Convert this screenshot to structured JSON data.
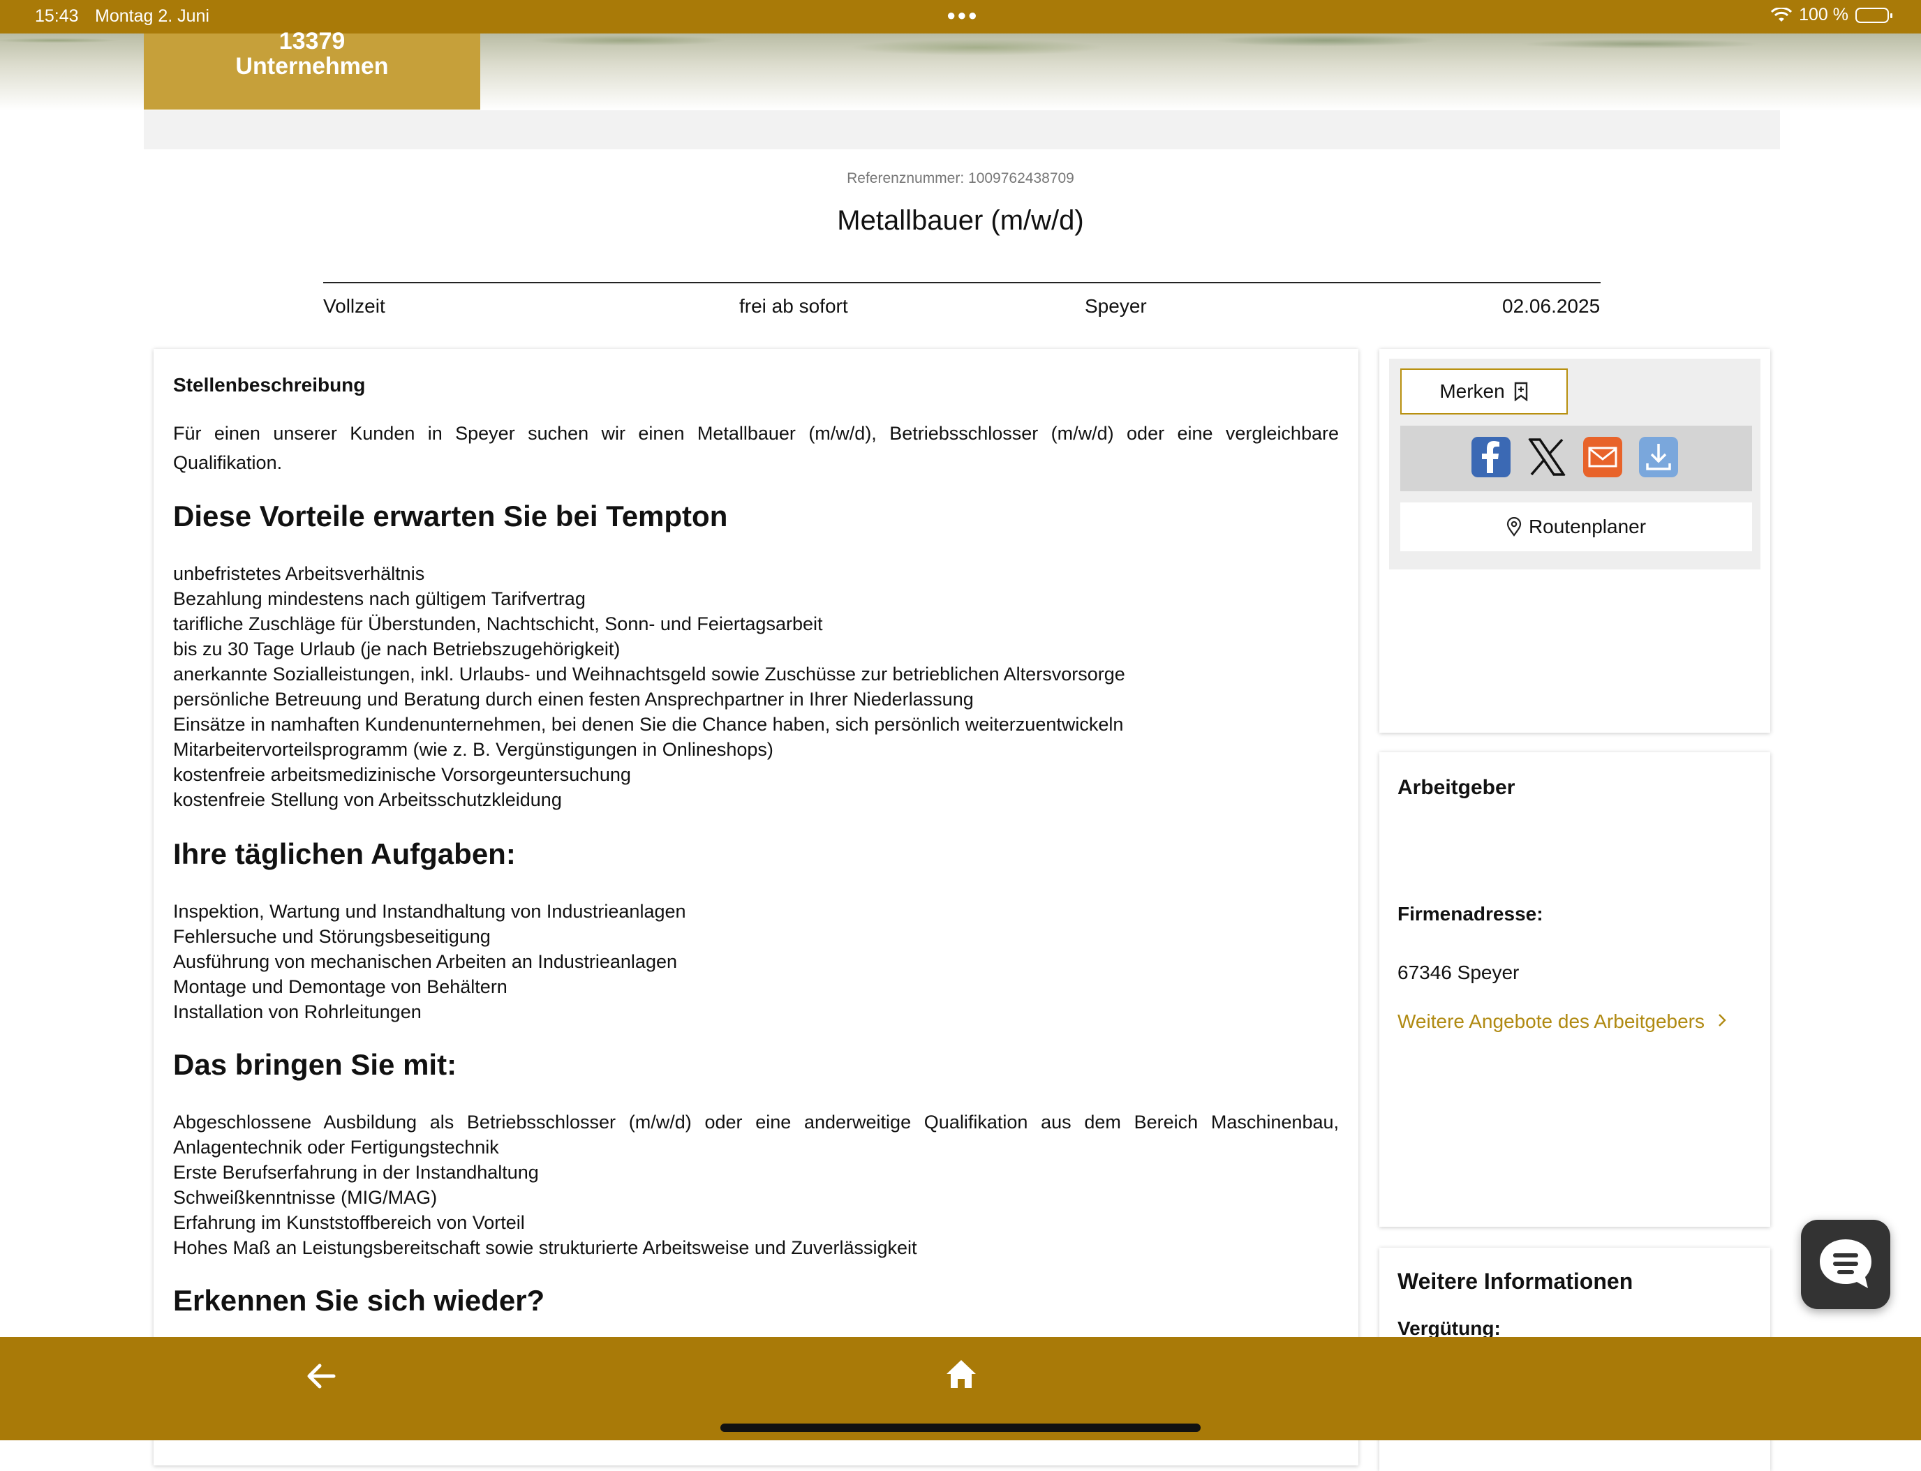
{
  "status_bar": {
    "time": "15:43",
    "date": "Montag 2. Juni",
    "battery": "100 %"
  },
  "header": {
    "company_count": "13379",
    "company_label": "Unternehmen"
  },
  "job": {
    "reference": "Referenznummer: 1009762438709",
    "title": "Metallbauer (m/w/d)",
    "employment_type": "Vollzeit",
    "availability": "frei ab sofort",
    "location": "Speyer",
    "date": "02.06.2025"
  },
  "description": {
    "section_label": "Stellenbeschreibung",
    "intro": "Für einen unserer Kunden in Speyer suchen wir einen Metallbauer (m/w/d), Betriebsschlosser (m/w/d) oder eine vergleichbare Qualifikation.",
    "benefits_heading": "Diese Vorteile erwarten Sie bei Tempton",
    "benefits": [
      "unbefristetes Arbeitsverhältnis",
      "Bezahlung mindestens nach gültigem Tarifvertrag",
      "tarifliche Zuschläge für Überstunden, Nachtschicht, Sonn- und Feiertagsarbeit",
      "bis zu 30 Tage Urlaub (je nach Betriebszugehörigkeit)",
      "anerkannte Sozialleistungen, inkl. Urlaubs- und Weihnachtsgeld sowie Zuschüsse zur betrieblichen Altersvorsorge",
      "persönliche Betreuung und Beratung durch einen festen Ansprechpartner in Ihrer Niederlassung",
      "Einsätze in namhaften Kundenunternehmen, bei denen Sie die Chance haben, sich persönlich weiterzuentwickeln",
      "Mitarbeitervorteilsprogramm (wie z. B. Vergünstigungen in Onlineshops)",
      "kostenfreie arbeitsmedizinische Vorsorgeuntersuchung",
      "kostenfreie Stellung von Arbeitsschutzkleidung"
    ],
    "tasks_heading": "Ihre täglichen Aufgaben:",
    "tasks": [
      "Inspektion, Wartung und Instandhaltung von Industrieanlagen",
      "Fehlersuche und Störungsbeseitigung",
      "Ausführung von mechanischen Arbeiten an Industrieanlagen",
      "Montage und Demontage von Behältern",
      "Installation von Rohrleitungen"
    ],
    "requirements_heading": "Das bringen Sie mit:",
    "requirements": [
      "Abgeschlossene Ausbildung als Betriebsschlosser (m/w/d) oder eine anderweitige Qualifikation aus dem Bereich Maschinenbau, Anlagentechnik oder Fertigungstechnik",
      "Erste Berufserfahrung in der Instandhaltung",
      "Schweißkenntnisse (MIG/MAG)",
      "Erfahrung im Kunststoffbereich von Vorteil",
      "Hohes Maß an Leistungsbereitschaft sowie strukturierte Arbeitsweise und Zuverlässigkeit"
    ],
    "closing_heading": "Erkennen Sie sich wieder?"
  },
  "actions": {
    "bookmark_label": "Merken",
    "route_label": "Routenplaner",
    "share_icons": [
      "facebook-icon",
      "x-icon",
      "email-icon",
      "download-icon"
    ]
  },
  "employer": {
    "heading": "Arbeitgeber",
    "address_label": "Firmenadresse:",
    "address": "67346 Speyer",
    "more_offers_link": "Weitere Angebote des Arbeitgebers"
  },
  "more_info": {
    "heading": "Weitere Informationen",
    "salary_label": "Vergütung:"
  },
  "colors": {
    "brand": "#a97a08",
    "accent_box": "#c6a03a",
    "link": "#b08a12"
  }
}
